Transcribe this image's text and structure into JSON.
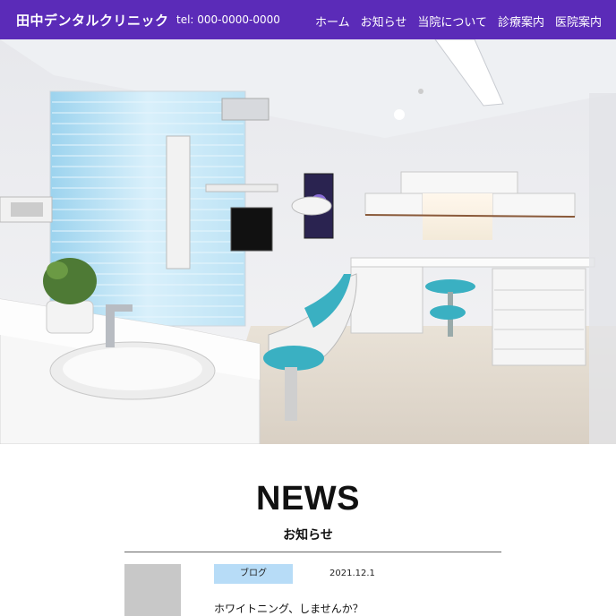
{
  "header": {
    "clinic_name": "田中デンタルクリニック",
    "tel": "tel: 000-0000-0000",
    "nav": [
      {
        "label": "ホーム"
      },
      {
        "label": "お知らせ"
      },
      {
        "label": "当院について"
      },
      {
        "label": "診療案内"
      },
      {
        "label": "医院案内"
      }
    ]
  },
  "colors": {
    "header_bg": "#5b2bb8",
    "tag_bg": "#b7dcf7",
    "chair_accent": "#3ab0c2"
  },
  "hero": {
    "image": "dental-clinic-treatment-room-photo"
  },
  "news": {
    "title": "NEWS",
    "subtitle": "お知らせ",
    "items": [
      {
        "category": "ブログ",
        "date": "2021.12.1",
        "headline": "ホワイトニング、しませんか？"
      }
    ]
  }
}
